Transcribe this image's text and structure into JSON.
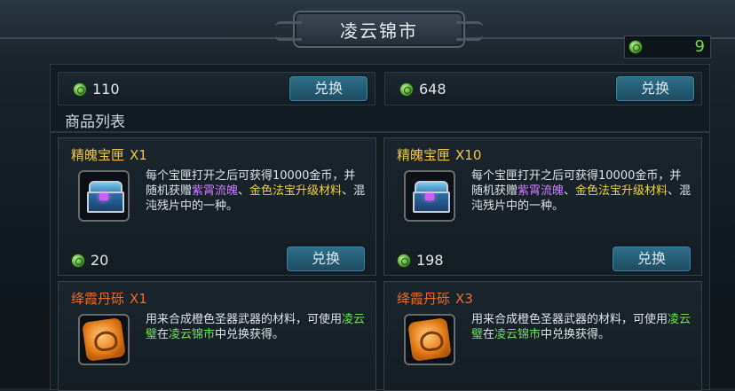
{
  "header": {
    "title": "凌云锦市"
  },
  "currency": {
    "icon": "jade-coin-icon",
    "amount": "9"
  },
  "top_items": [
    {
      "price": "110",
      "button": "兑换"
    },
    {
      "price": "648",
      "button": "兑换"
    }
  ],
  "section": {
    "title": "商品列表"
  },
  "items": [
    {
      "name": "精魄宝匣",
      "qty": "X1",
      "icon": "treasure-chest-icon",
      "desc": {
        "p1": "每个宝匣打开之后可获得10000金币，并随机获赠",
        "h1": "紫霄流魄",
        "p2": "、",
        "h2": "金色法宝升级材料",
        "p3": "、混沌残片中的一种。"
      },
      "price": "20",
      "button": "兑换"
    },
    {
      "name": "精魄宝匣",
      "qty": "X10",
      "icon": "treasure-chest-icon",
      "desc": {
        "p1": "每个宝匣打开之后可获得10000金币，并随机获赠",
        "h1": "紫霄流魄",
        "p2": "、",
        "h2": "金色法宝升级材料",
        "p3": "、混沌残片中的一种。"
      },
      "price": "198",
      "button": "兑换"
    },
    {
      "name": "绛霞丹砾",
      "qty": "X1",
      "icon": "dan-stone-icon",
      "desc": {
        "p1": "用来合成橙色圣器武器的材料，可使用",
        "h1": "凌云璧",
        "p2": "在",
        "h2": "凌云锦市",
        "p3": "中兑换获得。"
      }
    },
    {
      "name": "绛霞丹砾",
      "qty": "X3",
      "icon": "dan-stone-icon",
      "desc": {
        "p1": "用来合成橙色圣器武器的材料，可使用",
        "h1": "凌云璧",
        "p2": "在",
        "h2": "凌云锦市",
        "p3": "中兑换获得。"
      }
    }
  ],
  "colors": {
    "item_name_a": "#f0c64a",
    "item_name_b": "#f06a2a",
    "button": "#2e6f8a"
  }
}
